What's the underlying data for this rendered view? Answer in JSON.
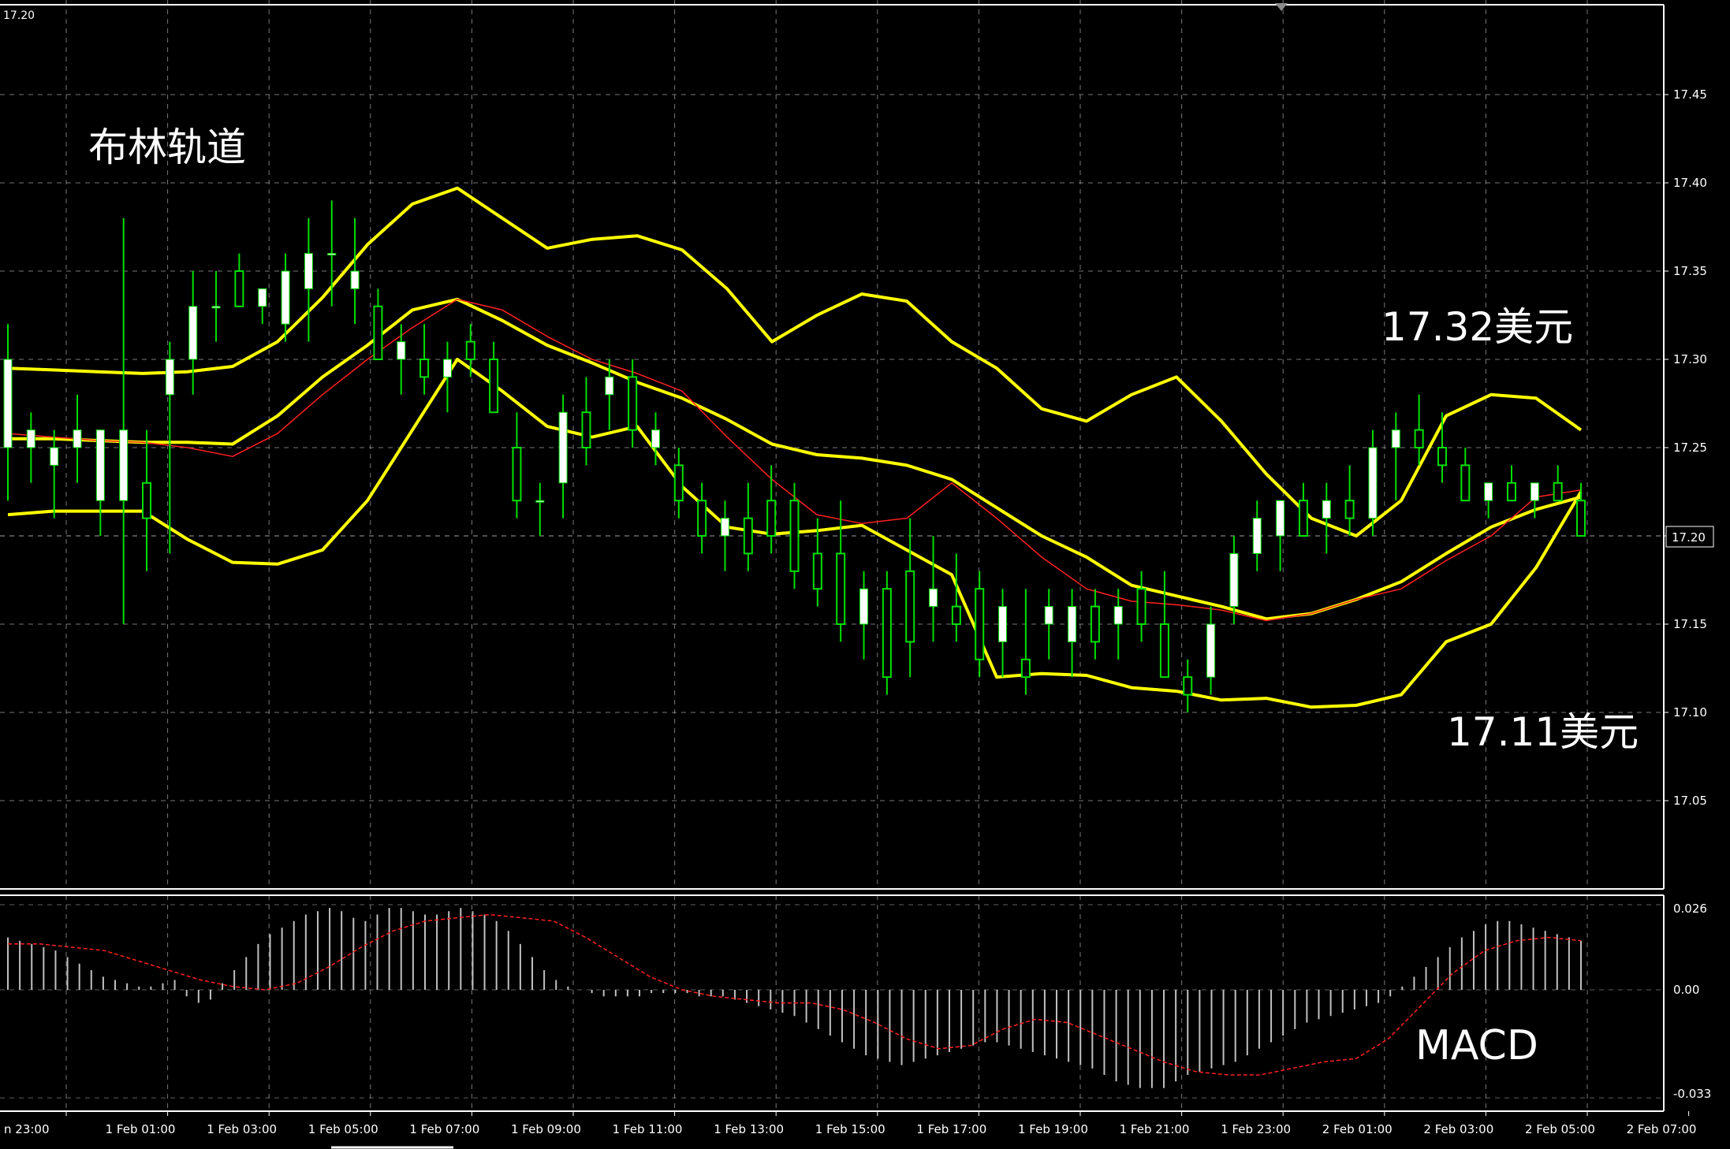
{
  "chart_data": [
    {
      "type": "candlestick",
      "title": "布林轨道",
      "price_corner_label": "17.20",
      "ylim": [
        17.0,
        17.5
      ],
      "yticks": [
        "17.45",
        "17.40",
        "17.35",
        "17.30",
        "17.25",
        "17.20",
        "17.15",
        "17.10",
        "17.05"
      ],
      "current_price_label": "17.20",
      "annotations": [
        {
          "text": "17.32美元"
        },
        {
          "text": "17.11美元"
        }
      ],
      "colors": {
        "bands": "#ffff00",
        "ma": "#ff2020",
        "candle_up": "#ffffff",
        "candle_wick": "#00e000",
        "grid": "#a0a0a0"
      },
      "upper_band": [
        17.295,
        17.294,
        17.293,
        17.292,
        17.293,
        17.296,
        17.31,
        17.335,
        17.365,
        17.388,
        17.397,
        17.38,
        17.363,
        17.368,
        17.37,
        17.362,
        17.34,
        17.31,
        17.325,
        17.337,
        17.333,
        17.31,
        17.295,
        17.272,
        17.265,
        17.28,
        17.29,
        17.265,
        17.235,
        17.21,
        17.2,
        17.22,
        17.268,
        17.28,
        17.278,
        17.26
      ],
      "middle_band": [
        17.255,
        17.255,
        17.254,
        17.253,
        17.253,
        17.252,
        17.268,
        17.29,
        17.308,
        17.328,
        17.334,
        17.322,
        17.308,
        17.298,
        17.287,
        17.278,
        17.266,
        17.252,
        17.246,
        17.244,
        17.24,
        17.232,
        17.216,
        17.2,
        17.188,
        17.172,
        17.166,
        17.16,
        17.153,
        17.156,
        17.164,
        17.174,
        17.19,
        17.205,
        17.215,
        17.222
      ],
      "lower_band": [
        17.212,
        17.214,
        17.214,
        17.214,
        17.198,
        17.185,
        17.184,
        17.192,
        17.22,
        17.26,
        17.3,
        17.282,
        17.262,
        17.256,
        17.262,
        17.228,
        17.205,
        17.201,
        17.203,
        17.206,
        17.192,
        17.178,
        17.12,
        17.122,
        17.121,
        17.114,
        17.112,
        17.107,
        17.108,
        17.103,
        17.104,
        17.11,
        17.14,
        17.15,
        17.182,
        17.225
      ],
      "ma": [
        17.258,
        17.256,
        17.254,
        17.253,
        17.25,
        17.245,
        17.258,
        17.28,
        17.3,
        17.318,
        17.334,
        17.328,
        17.313,
        17.3,
        17.292,
        17.282,
        17.256,
        17.232,
        17.212,
        17.207,
        17.21,
        17.23,
        17.21,
        17.188,
        17.17,
        17.163,
        17.161,
        17.158,
        17.152,
        17.156,
        17.164,
        17.17,
        17.186,
        17.2,
        17.222,
        17.226
      ],
      "candles": [
        {
          "o": 17.25,
          "h": 17.32,
          "l": 17.22,
          "c": 17.3
        },
        {
          "o": 17.25,
          "h": 17.27,
          "l": 17.23,
          "c": 17.26
        },
        {
          "o": 17.24,
          "h": 17.26,
          "l": 17.21,
          "c": 17.25
        },
        {
          "o": 17.25,
          "h": 17.28,
          "l": 17.23,
          "c": 17.26
        },
        {
          "o": 17.22,
          "h": 17.26,
          "l": 17.2,
          "c": 17.26
        },
        {
          "o": 17.22,
          "h": 17.38,
          "l": 17.15,
          "c": 17.26
        },
        {
          "o": 17.23,
          "h": 17.26,
          "l": 17.18,
          "c": 17.21
        },
        {
          "o": 17.28,
          "h": 17.31,
          "l": 17.19,
          "c": 17.3
        },
        {
          "o": 17.3,
          "h": 17.35,
          "l": 17.28,
          "c": 17.33
        },
        {
          "o": 17.33,
          "h": 17.35,
          "l": 17.31,
          "c": 17.33
        },
        {
          "o": 17.35,
          "h": 17.36,
          "l": 17.33,
          "c": 17.33
        },
        {
          "o": 17.33,
          "h": 17.34,
          "l": 17.32,
          "c": 17.34
        },
        {
          "o": 17.32,
          "h": 17.36,
          "l": 17.31,
          "c": 17.35
        },
        {
          "o": 17.34,
          "h": 17.38,
          "l": 17.31,
          "c": 17.36
        },
        {
          "o": 17.36,
          "h": 17.39,
          "l": 17.33,
          "c": 17.36
        },
        {
          "o": 17.34,
          "h": 17.38,
          "l": 17.32,
          "c": 17.35
        },
        {
          "o": 17.33,
          "h": 17.34,
          "l": 17.3,
          "c": 17.3
        },
        {
          "o": 17.3,
          "h": 17.32,
          "l": 17.28,
          "c": 17.31
        },
        {
          "o": 17.3,
          "h": 17.32,
          "l": 17.28,
          "c": 17.29
        },
        {
          "o": 17.29,
          "h": 17.31,
          "l": 17.27,
          "c": 17.3
        },
        {
          "o": 17.31,
          "h": 17.32,
          "l": 17.29,
          "c": 17.3
        },
        {
          "o": 17.3,
          "h": 17.31,
          "l": 17.27,
          "c": 17.27
        },
        {
          "o": 17.25,
          "h": 17.27,
          "l": 17.21,
          "c": 17.22
        },
        {
          "o": 17.22,
          "h": 17.23,
          "l": 17.2,
          "c": 17.22
        },
        {
          "o": 17.23,
          "h": 17.28,
          "l": 17.21,
          "c": 17.27
        },
        {
          "o": 17.27,
          "h": 17.29,
          "l": 17.24,
          "c": 17.25
        },
        {
          "o": 17.28,
          "h": 17.3,
          "l": 17.26,
          "c": 17.29
        },
        {
          "o": 17.29,
          "h": 17.3,
          "l": 17.25,
          "c": 17.26
        },
        {
          "o": 17.25,
          "h": 17.27,
          "l": 17.24,
          "c": 17.26
        },
        {
          "o": 17.24,
          "h": 17.25,
          "l": 17.21,
          "c": 17.22
        },
        {
          "o": 17.22,
          "h": 17.23,
          "l": 17.19,
          "c": 17.2
        },
        {
          "o": 17.2,
          "h": 17.22,
          "l": 17.18,
          "c": 17.21
        },
        {
          "o": 17.21,
          "h": 17.23,
          "l": 17.18,
          "c": 17.19
        },
        {
          "o": 17.22,
          "h": 17.24,
          "l": 17.19,
          "c": 17.2
        },
        {
          "o": 17.22,
          "h": 17.23,
          "l": 17.17,
          "c": 17.18
        },
        {
          "o": 17.19,
          "h": 17.21,
          "l": 17.16,
          "c": 17.17
        },
        {
          "o": 17.19,
          "h": 17.22,
          "l": 17.14,
          "c": 17.15
        },
        {
          "o": 17.15,
          "h": 17.18,
          "l": 17.13,
          "c": 17.17
        },
        {
          "o": 17.17,
          "h": 17.18,
          "l": 17.11,
          "c": 17.12
        },
        {
          "o": 17.18,
          "h": 17.21,
          "l": 17.12,
          "c": 17.14
        },
        {
          "o": 17.16,
          "h": 17.2,
          "l": 17.14,
          "c": 17.17
        },
        {
          "o": 17.16,
          "h": 17.19,
          "l": 17.14,
          "c": 17.15
        },
        {
          "o": 17.17,
          "h": 17.18,
          "l": 17.12,
          "c": 17.13
        },
        {
          "o": 17.14,
          "h": 17.17,
          "l": 17.12,
          "c": 17.16
        },
        {
          "o": 17.13,
          "h": 17.17,
          "l": 17.11,
          "c": 17.12
        },
        {
          "o": 17.15,
          "h": 17.17,
          "l": 17.13,
          "c": 17.16
        },
        {
          "o": 17.14,
          "h": 17.17,
          "l": 17.12,
          "c": 17.16
        },
        {
          "o": 17.16,
          "h": 17.17,
          "l": 17.13,
          "c": 17.14
        },
        {
          "o": 17.15,
          "h": 17.17,
          "l": 17.13,
          "c": 17.16
        },
        {
          "o": 17.17,
          "h": 17.18,
          "l": 17.14,
          "c": 17.15
        },
        {
          "o": 17.15,
          "h": 17.18,
          "l": 17.12,
          "c": 17.12
        },
        {
          "o": 17.12,
          "h": 17.13,
          "l": 17.1,
          "c": 17.11
        },
        {
          "o": 17.12,
          "h": 17.16,
          "l": 17.11,
          "c": 17.15
        },
        {
          "o": 17.16,
          "h": 17.2,
          "l": 17.15,
          "c": 17.19
        },
        {
          "o": 17.19,
          "h": 17.22,
          "l": 17.18,
          "c": 17.21
        },
        {
          "o": 17.2,
          "h": 17.22,
          "l": 17.18,
          "c": 17.22
        },
        {
          "o": 17.22,
          "h": 17.23,
          "l": 17.2,
          "c": 17.2
        },
        {
          "o": 17.21,
          "h": 17.23,
          "l": 17.19,
          "c": 17.22
        },
        {
          "o": 17.22,
          "h": 17.24,
          "l": 17.2,
          "c": 17.21
        },
        {
          "o": 17.21,
          "h": 17.26,
          "l": 17.2,
          "c": 17.25
        },
        {
          "o": 17.25,
          "h": 17.27,
          "l": 17.22,
          "c": 17.26
        },
        {
          "o": 17.26,
          "h": 17.28,
          "l": 17.24,
          "c": 17.25
        },
        {
          "o": 17.25,
          "h": 17.27,
          "l": 17.23,
          "c": 17.24
        },
        {
          "o": 17.24,
          "h": 17.25,
          "l": 17.22,
          "c": 17.22
        },
        {
          "o": 17.22,
          "h": 17.23,
          "l": 17.21,
          "c": 17.23
        },
        {
          "o": 17.23,
          "h": 17.24,
          "l": 17.22,
          "c": 17.22
        },
        {
          "o": 17.22,
          "h": 17.23,
          "l": 17.21,
          "c": 17.23
        },
        {
          "o": 17.23,
          "h": 17.24,
          "l": 17.22,
          "c": 17.22
        },
        {
          "o": 17.22,
          "h": 17.23,
          "l": 17.2,
          "c": 17.2
        }
      ]
    },
    {
      "type": "bar",
      "title": "MACD",
      "ylim": [
        -0.033,
        0.026
      ],
      "yticks": [
        "0.026",
        "0.00",
        "-0.033"
      ],
      "colors": {
        "histogram": "#c0c0c0",
        "signal": "#ff2020"
      },
      "histogram": [
        0.016,
        0.015,
        0.014,
        0.013,
        0.012,
        0.01,
        0.008,
        0.006,
        0.004,
        0.003,
        0.002,
        0.001,
        0.001,
        0.002,
        0.003,
        -0.002,
        -0.004,
        -0.003,
        0.002,
        0.006,
        0.01,
        0.014,
        0.017,
        0.019,
        0.021,
        0.023,
        0.024,
        0.025,
        0.024,
        0.022,
        0.021,
        0.023,
        0.025,
        0.025,
        0.024,
        0.023,
        0.023,
        0.024,
        0.025,
        0.024,
        0.023,
        0.021,
        0.018,
        0.014,
        0.01,
        0.006,
        0.003,
        0.001,
        0.0,
        -0.001,
        -0.002,
        -0.002,
        -0.002,
        -0.002,
        -0.001,
        -0.001,
        -0.001,
        -0.001,
        -0.002,
        -0.002,
        -0.002,
        -0.003,
        -0.004,
        -0.005,
        -0.006,
        -0.007,
        -0.008,
        -0.01,
        -0.012,
        -0.014,
        -0.016,
        -0.018,
        -0.02,
        -0.021,
        -0.022,
        -0.023,
        -0.022,
        -0.021,
        -0.02,
        -0.019,
        -0.018,
        -0.017,
        -0.016,
        -0.016,
        -0.017,
        -0.018,
        -0.019,
        -0.02,
        -0.021,
        -0.022,
        -0.023,
        -0.024,
        -0.026,
        -0.028,
        -0.029,
        -0.03,
        -0.03,
        -0.03,
        -0.028,
        -0.026,
        -0.025,
        -0.024,
        -0.023,
        -0.022,
        -0.02,
        -0.018,
        -0.016,
        -0.014,
        -0.012,
        -0.01,
        -0.009,
        -0.008,
        -0.007,
        -0.006,
        -0.005,
        -0.004,
        -0.002,
        0.001,
        0.004,
        0.007,
        0.01,
        0.013,
        0.016,
        0.018,
        0.02,
        0.021,
        0.021,
        0.02,
        0.019,
        0.018,
        0.017,
        0.016,
        0.015
      ],
      "signal": [
        0.014,
        0.014,
        0.013,
        0.012,
        0.009,
        0.006,
        0.003,
        0.001,
        0.0,
        0.002,
        0.007,
        0.013,
        0.018,
        0.021,
        0.022,
        0.023,
        0.022,
        0.021,
        0.016,
        0.01,
        0.004,
        0.0,
        -0.002,
        -0.003,
        -0.004,
        -0.004,
        -0.006,
        -0.01,
        -0.015,
        -0.018,
        -0.017,
        -0.012,
        -0.009,
        -0.01,
        -0.014,
        -0.018,
        -0.022,
        -0.025,
        -0.026,
        -0.026,
        -0.024,
        -0.022,
        -0.021,
        -0.015,
        -0.005,
        0.005,
        0.012,
        0.015,
        0.016,
        0.015
      ]
    }
  ],
  "x_axis": {
    "labels": [
      "n 23:00",
      "1 Feb 01:00",
      "1 Feb 03:00",
      "1 Feb 05:00",
      "1 Feb 07:00",
      "1 Feb 09:00",
      "1 Feb 11:00",
      "1 Feb 13:00",
      "1 Feb 15:00",
      "1 Feb 17:00",
      "1 Feb 19:00",
      "1 Feb 21:00",
      "1 Feb 23:00",
      "2 Feb 01:00",
      "2 Feb 03:00",
      "2 Feb 05:00",
      "2 Feb 07:00"
    ]
  }
}
